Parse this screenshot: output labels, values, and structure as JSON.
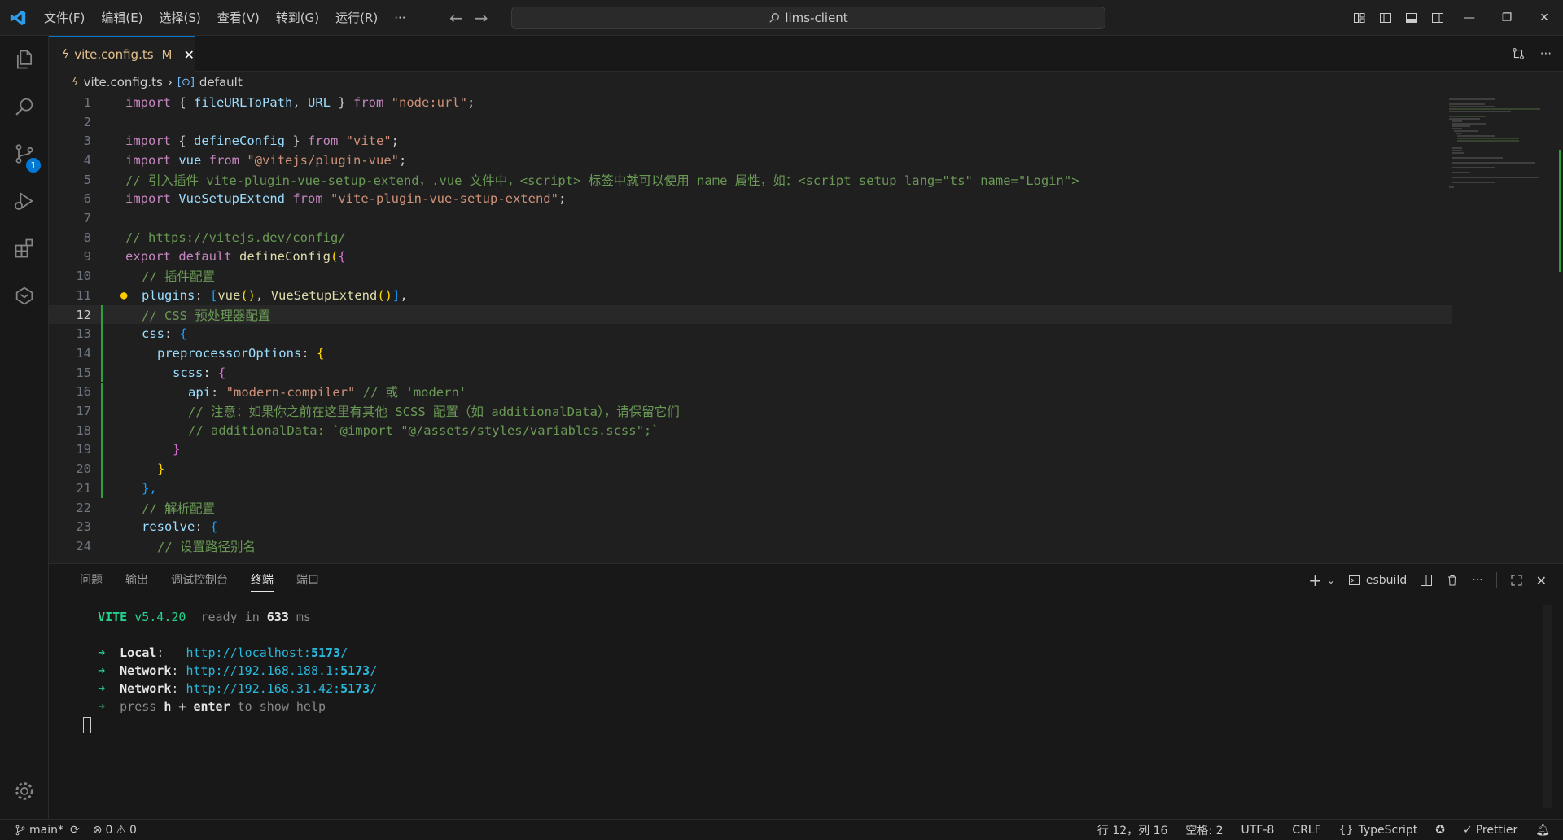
{
  "app": {
    "accent": "#0078d4",
    "modified_color": "#e2c08d"
  },
  "menu": [
    "文件(F)",
    "编辑(E)",
    "选择(S)",
    "查看(V)",
    "转到(G)",
    "运行(R)",
    "···"
  ],
  "search": {
    "text": "lims-client"
  },
  "activity_badge": "1",
  "tab": {
    "name": "vite.config.ts",
    "status": "M"
  },
  "breadcrumb": {
    "file": "vite.config.ts",
    "symbol": "default"
  },
  "code_lines": [
    {
      "n": "1"
    },
    {
      "n": "2"
    },
    {
      "n": "3"
    },
    {
      "n": "4"
    },
    {
      "n": "5"
    },
    {
      "n": "6"
    },
    {
      "n": "7"
    },
    {
      "n": "8"
    },
    {
      "n": "9"
    },
    {
      "n": "10"
    },
    {
      "n": "11"
    },
    {
      "n": "12"
    },
    {
      "n": "13"
    },
    {
      "n": "14"
    },
    {
      "n": "15"
    },
    {
      "n": "16"
    },
    {
      "n": "17"
    },
    {
      "n": "18"
    },
    {
      "n": "19"
    },
    {
      "n": "20"
    },
    {
      "n": "21"
    },
    {
      "n": "22"
    },
    {
      "n": "23"
    },
    {
      "n": "24"
    }
  ],
  "code": {
    "l1": [
      "import",
      " { ",
      "fileURLToPath",
      ", ",
      "URL",
      " } ",
      "from",
      " ",
      "\"node:url\"",
      ";"
    ],
    "l3": [
      "import",
      " { ",
      "defineConfig",
      " } ",
      "from",
      " ",
      "\"vite\"",
      ";"
    ],
    "l4": [
      "import",
      " ",
      "vue",
      " ",
      "from",
      " ",
      "\"@vitejs/plugin-vue\"",
      ";"
    ],
    "l5": "// 引入插件 vite-plugin-vue-setup-extend，.vue 文件中，<script> 标签中就可以使用 name 属性，如：<script setup lang=\"ts\" name=\"Login\">",
    "l6": [
      "import",
      " ",
      "VueSetupExtend",
      " ",
      "from",
      " ",
      "\"vite-plugin-vue-setup-extend\"",
      ";"
    ],
    "l8_prefix": "// ",
    "l8_link": "https://vitejs.dev/config/",
    "l9": [
      "export",
      " ",
      "default",
      " ",
      "defineConfig",
      "(",
      "{"
    ],
    "l10": "// 插件配置",
    "l11": [
      "plugins",
      ": ",
      "[",
      "vue",
      "()",
      ", ",
      "VueSetupExtend",
      "()",
      "]",
      ","
    ],
    "l12": "// CSS 预处理器配置",
    "l13": [
      "css",
      ": ",
      "{"
    ],
    "l14": [
      "preprocessorOptions",
      ": ",
      "{"
    ],
    "l15": [
      "scss",
      ": ",
      "{"
    ],
    "l16": [
      "api",
      ": ",
      "\"modern-compiler\"",
      " ",
      "// 或 'modern'"
    ],
    "l17": "// 注意：如果你之前在这里有其他 SCSS 配置（如 additionalData），请保留它们",
    "l18": "// additionalData: `@import \"@/assets/styles/variables.scss\";`",
    "l19": "}",
    "l20": "}",
    "l21": "},",
    "l22": "// 解析配置",
    "l23": [
      "resolve",
      ": ",
      "{"
    ],
    "l24": "// 设置路径别名"
  },
  "panel": {
    "tabs": [
      "问题",
      "输出",
      "调试控制台",
      "终端",
      "端口"
    ],
    "active_tab": "终端",
    "terminal_name": "esbuild"
  },
  "terminal": {
    "vite": "VITE",
    "version": "v5.4.20",
    "ready": "ready in",
    "ms_value": "633",
    "ms_unit": "ms",
    "arrow": "➜",
    "local_label": "Local",
    "local_url_prefix": "http://localhost:",
    "network_label": "Network",
    "net1_prefix": "http://192.168.188.1:",
    "net2_prefix": "http://192.168.31.42:",
    "port": "5173",
    "slash": "/",
    "help_press": "press",
    "help_keys": "h + enter",
    "help_rest": "to show help"
  },
  "status": {
    "branch": "main*",
    "errors": "0",
    "warnings": "0",
    "position": "行 12，列 16",
    "spaces": "空格: 2",
    "encoding": "UTF-8",
    "eol": "CRLF",
    "language": "TypeScript",
    "prettier": "Prettier"
  }
}
